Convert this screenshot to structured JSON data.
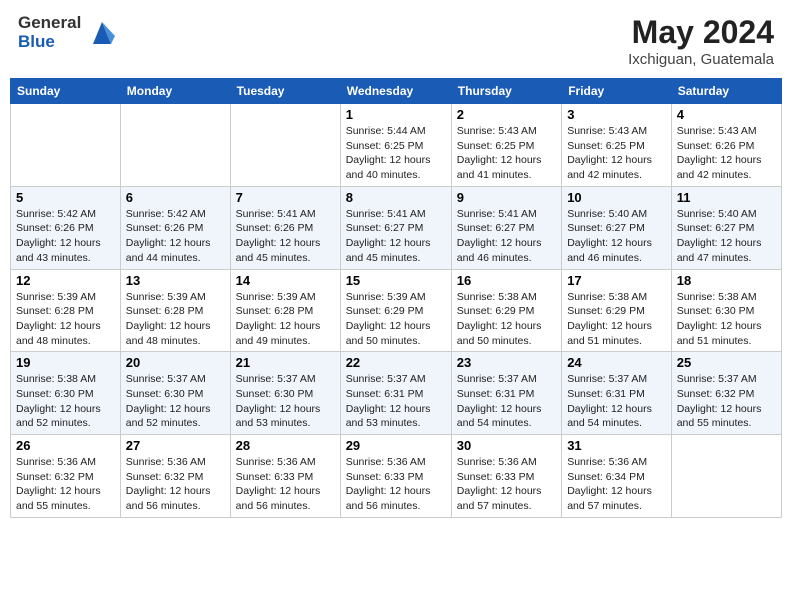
{
  "logo": {
    "general": "General",
    "blue": "Blue"
  },
  "title": {
    "month_year": "May 2024",
    "location": "Ixchiguan, Guatemala"
  },
  "days_of_week": [
    "Sunday",
    "Monday",
    "Tuesday",
    "Wednesday",
    "Thursday",
    "Friday",
    "Saturday"
  ],
  "weeks": [
    [
      {
        "day": "",
        "info": ""
      },
      {
        "day": "",
        "info": ""
      },
      {
        "day": "",
        "info": ""
      },
      {
        "day": "1",
        "info": "Sunrise: 5:44 AM\nSunset: 6:25 PM\nDaylight: 12 hours\nand 40 minutes."
      },
      {
        "day": "2",
        "info": "Sunrise: 5:43 AM\nSunset: 6:25 PM\nDaylight: 12 hours\nand 41 minutes."
      },
      {
        "day": "3",
        "info": "Sunrise: 5:43 AM\nSunset: 6:25 PM\nDaylight: 12 hours\nand 42 minutes."
      },
      {
        "day": "4",
        "info": "Sunrise: 5:43 AM\nSunset: 6:26 PM\nDaylight: 12 hours\nand 42 minutes."
      }
    ],
    [
      {
        "day": "5",
        "info": "Sunrise: 5:42 AM\nSunset: 6:26 PM\nDaylight: 12 hours\nand 43 minutes."
      },
      {
        "day": "6",
        "info": "Sunrise: 5:42 AM\nSunset: 6:26 PM\nDaylight: 12 hours\nand 44 minutes."
      },
      {
        "day": "7",
        "info": "Sunrise: 5:41 AM\nSunset: 6:26 PM\nDaylight: 12 hours\nand 45 minutes."
      },
      {
        "day": "8",
        "info": "Sunrise: 5:41 AM\nSunset: 6:27 PM\nDaylight: 12 hours\nand 45 minutes."
      },
      {
        "day": "9",
        "info": "Sunrise: 5:41 AM\nSunset: 6:27 PM\nDaylight: 12 hours\nand 46 minutes."
      },
      {
        "day": "10",
        "info": "Sunrise: 5:40 AM\nSunset: 6:27 PM\nDaylight: 12 hours\nand 46 minutes."
      },
      {
        "day": "11",
        "info": "Sunrise: 5:40 AM\nSunset: 6:27 PM\nDaylight: 12 hours\nand 47 minutes."
      }
    ],
    [
      {
        "day": "12",
        "info": "Sunrise: 5:39 AM\nSunset: 6:28 PM\nDaylight: 12 hours\nand 48 minutes."
      },
      {
        "day": "13",
        "info": "Sunrise: 5:39 AM\nSunset: 6:28 PM\nDaylight: 12 hours\nand 48 minutes."
      },
      {
        "day": "14",
        "info": "Sunrise: 5:39 AM\nSunset: 6:28 PM\nDaylight: 12 hours\nand 49 minutes."
      },
      {
        "day": "15",
        "info": "Sunrise: 5:39 AM\nSunset: 6:29 PM\nDaylight: 12 hours\nand 50 minutes."
      },
      {
        "day": "16",
        "info": "Sunrise: 5:38 AM\nSunset: 6:29 PM\nDaylight: 12 hours\nand 50 minutes."
      },
      {
        "day": "17",
        "info": "Sunrise: 5:38 AM\nSunset: 6:29 PM\nDaylight: 12 hours\nand 51 minutes."
      },
      {
        "day": "18",
        "info": "Sunrise: 5:38 AM\nSunset: 6:30 PM\nDaylight: 12 hours\nand 51 minutes."
      }
    ],
    [
      {
        "day": "19",
        "info": "Sunrise: 5:38 AM\nSunset: 6:30 PM\nDaylight: 12 hours\nand 52 minutes."
      },
      {
        "day": "20",
        "info": "Sunrise: 5:37 AM\nSunset: 6:30 PM\nDaylight: 12 hours\nand 52 minutes."
      },
      {
        "day": "21",
        "info": "Sunrise: 5:37 AM\nSunset: 6:30 PM\nDaylight: 12 hours\nand 53 minutes."
      },
      {
        "day": "22",
        "info": "Sunrise: 5:37 AM\nSunset: 6:31 PM\nDaylight: 12 hours\nand 53 minutes."
      },
      {
        "day": "23",
        "info": "Sunrise: 5:37 AM\nSunset: 6:31 PM\nDaylight: 12 hours\nand 54 minutes."
      },
      {
        "day": "24",
        "info": "Sunrise: 5:37 AM\nSunset: 6:31 PM\nDaylight: 12 hours\nand 54 minutes."
      },
      {
        "day": "25",
        "info": "Sunrise: 5:37 AM\nSunset: 6:32 PM\nDaylight: 12 hours\nand 55 minutes."
      }
    ],
    [
      {
        "day": "26",
        "info": "Sunrise: 5:36 AM\nSunset: 6:32 PM\nDaylight: 12 hours\nand 55 minutes."
      },
      {
        "day": "27",
        "info": "Sunrise: 5:36 AM\nSunset: 6:32 PM\nDaylight: 12 hours\nand 56 minutes."
      },
      {
        "day": "28",
        "info": "Sunrise: 5:36 AM\nSunset: 6:33 PM\nDaylight: 12 hours\nand 56 minutes."
      },
      {
        "day": "29",
        "info": "Sunrise: 5:36 AM\nSunset: 6:33 PM\nDaylight: 12 hours\nand 56 minutes."
      },
      {
        "day": "30",
        "info": "Sunrise: 5:36 AM\nSunset: 6:33 PM\nDaylight: 12 hours\nand 57 minutes."
      },
      {
        "day": "31",
        "info": "Sunrise: 5:36 AM\nSunset: 6:34 PM\nDaylight: 12 hours\nand 57 minutes."
      },
      {
        "day": "",
        "info": ""
      }
    ]
  ]
}
